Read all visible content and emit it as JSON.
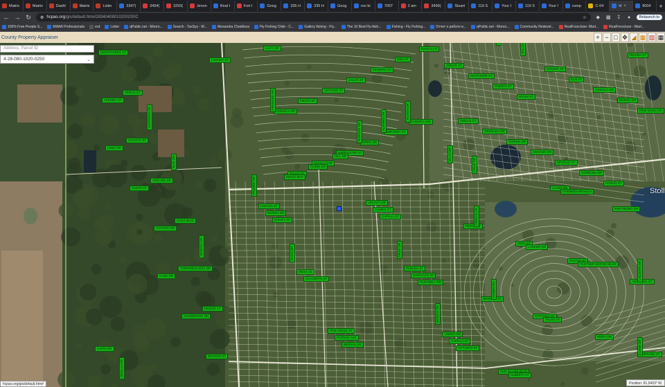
{
  "browser": {
    "tabs": [
      {
        "label": "Matrix",
        "color": "#c0392b"
      },
      {
        "label": "Matrix",
        "color": "#c0392b"
      },
      {
        "label": "Dashl",
        "color": "#c0392b"
      },
      {
        "label": "Matrix",
        "color": "#c0392b"
      },
      {
        "label": "Listin",
        "color": "#c0392b"
      },
      {
        "label": "3347(",
        "color": "#2b6cd8"
      },
      {
        "label": "3494(",
        "color": "#d63a3a"
      },
      {
        "label": "3293(",
        "color": "#d63a3a"
      },
      {
        "label": "Jenon",
        "color": "#d63a3a"
      },
      {
        "label": "Real I",
        "color": "#2b6cd8"
      },
      {
        "label": "Fort I",
        "color": "#d63a3a"
      },
      {
        "label": "Goog",
        "color": "#2b6cd8"
      },
      {
        "label": "335 H",
        "color": "#2b6cd8"
      },
      {
        "label": "335 H",
        "color": "#2b6cd8"
      },
      {
        "label": "Goog",
        "color": "#2b6cd8"
      },
      {
        "label": "reo bi",
        "color": "#2b6cd8"
      },
      {
        "label": "7007",
        "color": "#2b6cd8"
      },
      {
        "label": "2 am",
        "color": "#d63a3a"
      },
      {
        "label": "3499(",
        "color": "#d63a3a"
      },
      {
        "label": "Stuart",
        "color": "#2b6cd8"
      },
      {
        "label": "119 S",
        "color": "#2b6cd8"
      },
      {
        "label": "Your I",
        "color": "#2b6cd8"
      },
      {
        "label": "119 S",
        "color": "#2b6cd8"
      },
      {
        "label": "Your I",
        "color": "#2b6cd8"
      },
      {
        "label": "comp",
        "color": "#2b6cd8"
      },
      {
        "label": "C-04",
        "color": "#e0b400"
      },
      {
        "label": "H",
        "color": "#2b6cd8",
        "active": true
      },
      {
        "label": "8004",
        "color": "#2b6cd8"
      }
    ],
    "new_tab_label": "+",
    "url_host": "hcpao.org",
    "url_path": "/gis/default.htm#283404080102002S0C",
    "relaunch_label": "Relaunch to",
    "bookmarks": [
      {
        "label": "100% Free People S...",
        "color": "#2b6cd8"
      },
      {
        "label": "MIAMI Professionals",
        "color": "#2b6cd8"
      },
      {
        "label": "erd",
        "color": "#555555"
      },
      {
        "label": "Letter",
        "color": "#2b6cd8"
      },
      {
        "label": "qPublic.net - Monro...",
        "color": "#2b6cd8"
      },
      {
        "label": "Search - TaxSys - M...",
        "color": "#2b6cd8"
      },
      {
        "label": "Alexandra Chadilova",
        "color": "#2b6cd8"
      },
      {
        "label": "Fly Fishing Chile - C...",
        "color": "#2b6cd8"
      },
      {
        "label": "Gallery fishing - Fly...",
        "color": "#2b6cd8"
      },
      {
        "label": "The 10 Best Fly-fishi...",
        "color": "#2b6cd8"
      },
      {
        "label": "Fishing - Fly Fishing...",
        "color": "#2b6cd8"
      },
      {
        "label": "Отчет о работе в...",
        "color": "#2b6cd8"
      },
      {
        "label": "qPublic.net - Monro...",
        "color": "#2b6cd8"
      },
      {
        "label": "Community Redevel...",
        "color": "#2b6cd8"
      },
      {
        "label": "RealForeclose- Mart...",
        "color": "#d63a3a"
      },
      {
        "label": "RealForeclose - Mart...",
        "color": "#d63a3a"
      }
    ]
  },
  "app": {
    "title": "County Property Appraiser",
    "search_placeholder": "Address, Parcel ID",
    "parcel_value": "4-28-080-1020-0250",
    "tool_icons": [
      "zoom-in-icon",
      "zoom-out-icon",
      "zoom-box-icon",
      "pan-icon",
      "measure-icon",
      "layers-icon",
      "print-icon",
      "grid-icon"
    ],
    "status_url": "hcpao.org/gis/default.htm#",
    "position": "Position: 81.5403° W,",
    "place_label": "Stoll"
  },
  "street_labels": [
    {
      "text": "LUCY DR",
      "v": false
    },
    {
      "text": "DAILEY AV",
      "v": false
    },
    {
      "text": "WYNN ST",
      "v": false
    },
    {
      "text": "SALTUS ST",
      "v": false
    },
    {
      "text": "LEMA DR",
      "v": false
    },
    {
      "text": "TALCO ST",
      "v": false
    },
    {
      "text": "VITTURIO ST",
      "v": false
    },
    {
      "text": "PUERTA ST",
      "v": false
    },
    {
      "text": "LLANO DR",
      "v": false
    },
    {
      "text": "CASE DR",
      "v": false
    },
    {
      "text": "ALCALA AVE",
      "v": false
    },
    {
      "text": "PARADELA DR",
      "v": false
    },
    {
      "text": "MAGGIORE ST",
      "v": false
    },
    {
      "text": "COSTADO ST",
      "v": false
    },
    {
      "text": "LAGUNA ST",
      "v": false
    },
    {
      "text": "HAPPYACRE ST",
      "v": false
    },
    {
      "text": "CAPILLA ST",
      "v": false
    },
    {
      "text": "ZONAR ST",
      "v": false
    },
    {
      "text": "VERA ST",
      "v": false
    },
    {
      "text": "COSTA ST",
      "v": false
    },
    {
      "text": "ORRO DR",
      "v": false
    },
    {
      "text": "BERNAL DR",
      "v": false
    },
    {
      "text": "REGINA ST",
      "v": false
    },
    {
      "text": "SUN N LAKE BLVD",
      "v": false
    },
    {
      "text": "GLENBROOK DR",
      "v": false
    },
    {
      "text": "MIRANDA ST",
      "v": false
    },
    {
      "text": "SCHOEPPL ST",
      "v": false
    },
    {
      "text": "HARLIN ST",
      "v": false
    },
    {
      "text": "NEWTON ST",
      "v": false
    },
    {
      "text": "AVENIDA ST",
      "v": false
    },
    {
      "text": "ZAMORA AVE",
      "v": false
    },
    {
      "text": "RIVERA DR",
      "v": false
    },
    {
      "text": "CORDOBA DR",
      "v": false
    },
    {
      "text": "PESCA ST",
      "v": false
    },
    {
      "text": "COYOTE DR",
      "v": false
    },
    {
      "text": "CORSICA DR",
      "v": false
    },
    {
      "text": "CAPILLA ST",
      "v": false
    },
    {
      "text": "SPURLIN ST",
      "v": false
    },
    {
      "text": "SOPRANO ST",
      "v": false
    },
    {
      "text": "INFANTE ST",
      "v": false
    },
    {
      "text": "FIESTA ST",
      "v": false
    },
    {
      "text": "SANTIAGO ST",
      "v": false
    },
    {
      "text": "ARAGON DR",
      "v": false
    },
    {
      "text": "ANGELINA ST",
      "v": false
    },
    {
      "text": "GAVIOTA ST",
      "v": false
    },
    {
      "text": "ANTONIO ST",
      "v": false
    },
    {
      "text": "CAMEO ST",
      "v": false
    },
    {
      "text": "TORINO DR",
      "v": false
    },
    {
      "text": "SAN PEDRO DR",
      "v": false
    },
    {
      "text": "TORREMOLINOS DR",
      "v": false
    },
    {
      "text": "CALVO ST",
      "v": false
    },
    {
      "text": "PATRICK AVE",
      "v": false
    },
    {
      "text": "GRENADA DR",
      "v": false
    },
    {
      "text": "MORA DR",
      "v": false
    },
    {
      "text": "MONTEVIDEO ST",
      "v": false
    },
    {
      "text": "MADEIRA ST",
      "v": false
    },
    {
      "text": "MESA LN",
      "v": false
    },
    {
      "text": "CIRCLE CT",
      "v": false
    },
    {
      "text": "PANTHER WOODS BLVD",
      "v": false
    },
    {
      "text": "ADELINE DR",
      "v": false
    },
    {
      "text": "END ST",
      "v": false
    },
    {
      "text": "HAVANA ST",
      "v": false
    },
    {
      "text": "PINE MOSS DR",
      "v": false
    },
    {
      "text": "FARMERS BRANCH",
      "v": false
    },
    {
      "text": "MANOR CT",
      "v": false
    },
    {
      "text": "RANCH LN",
      "v": false
    },
    {
      "text": "LINDEN DR",
      "v": false
    },
    {
      "text": "MANSO DR",
      "v": false
    },
    {
      "text": "TALOS ST",
      "v": false
    },
    {
      "text": "VENUS ST",
      "v": false
    },
    {
      "text": "KINGS WAY",
      "v": false
    },
    {
      "text": "PARADA ST",
      "v": false
    },
    {
      "text": "JAMAICA DR",
      "v": false
    },
    {
      "text": "LANCER DR",
      "v": false
    },
    {
      "text": "OAKS BLVD",
      "v": false
    },
    {
      "text": "ROBIN DR",
      "v": false
    },
    {
      "text": "LEGACY DR",
      "v": false
    },
    {
      "text": "ELM ST",
      "v": false
    },
    {
      "text": "ALBERTA ST",
      "v": false
    },
    {
      "text": "CAPRI DR",
      "v": false
    },
    {
      "text": "HILL DR",
      "v": false
    },
    {
      "text": "PINE RIDGE ST",
      "v": false
    },
    {
      "text": "SUNSET ST",
      "v": false
    },
    {
      "text": "HOBBS RD",
      "v": true
    },
    {
      "text": "HASTINGS DR",
      "v": true
    },
    {
      "text": "NORTON DR",
      "v": true
    },
    {
      "text": "ELIAS DR",
      "v": true
    },
    {
      "text": "VALLEY DR",
      "v": true
    },
    {
      "text": "ORIOLE DR",
      "v": true
    },
    {
      "text": "SERENO DR",
      "v": true
    },
    {
      "text": "ALVAREZ DR",
      "v": true
    },
    {
      "text": "PALMER DR",
      "v": true
    },
    {
      "text": "DIXON ST",
      "v": true
    },
    {
      "text": "LANE DR",
      "v": true
    },
    {
      "text": "SEVILLA DR",
      "v": true
    },
    {
      "text": "TEJADA DR",
      "v": true
    },
    {
      "text": "MONDO DR",
      "v": true
    },
    {
      "text": "CRUZ DR",
      "v": true
    },
    {
      "text": "LACOSTA DR",
      "v": true
    },
    {
      "text": "RUIZ DR",
      "v": true
    },
    {
      "text": "FRANCES DR",
      "v": true
    },
    {
      "text": "MESA DR",
      "v": true
    },
    {
      "text": "VILLA DR",
      "v": true
    }
  ],
  "colors": {
    "label_bg": "#14b014",
    "parcel_line": "#e8e8c8",
    "aerial_dark": "#3f5532"
  }
}
